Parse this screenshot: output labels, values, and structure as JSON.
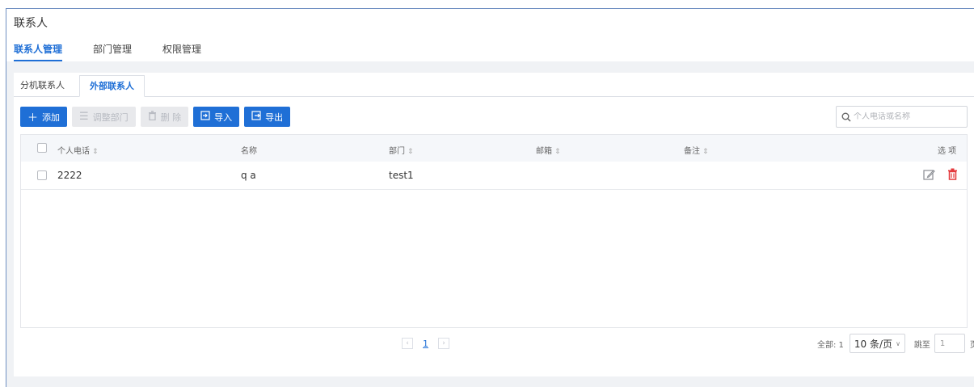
{
  "page_title": "联系人",
  "main_tabs": [
    {
      "label": "联系人管理",
      "active": true
    },
    {
      "label": "部门管理",
      "active": false
    },
    {
      "label": "权限管理",
      "active": false
    }
  ],
  "sub_tabs": [
    {
      "label": "分机联系人",
      "active": false
    },
    {
      "label": "外部联系人",
      "active": true
    }
  ],
  "toolbar": {
    "add": "添加",
    "adjust_dept": "调整部门",
    "delete": "删 除",
    "import": "导入",
    "export": "导出"
  },
  "search": {
    "placeholder": "个人电话或名称"
  },
  "table": {
    "headers": {
      "phone": "个人电话",
      "name": "名称",
      "dept": "部门",
      "email": "邮箱",
      "remark": "备注",
      "options": "选 项"
    },
    "sort_icon": "⇕",
    "rows": [
      {
        "phone": "2222",
        "name": "q a",
        "dept": "test1",
        "email": "",
        "remark": ""
      }
    ]
  },
  "pagination": {
    "prev": "‹",
    "current": "1",
    "next": "›",
    "total": "全部: 1",
    "page_size": "10 条/页",
    "jump_label": "跳至",
    "jump_value": "1",
    "page_unit": "页"
  },
  "colors": {
    "accent": "#1f6fd6",
    "danger": "#e4393c"
  }
}
